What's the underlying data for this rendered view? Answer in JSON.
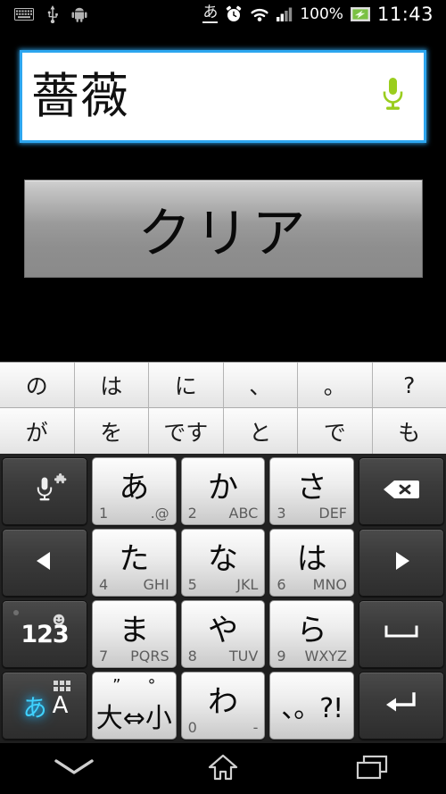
{
  "statusbar": {
    "left_icons": [
      "keyboard-icon",
      "usb-icon",
      "android-icon"
    ],
    "ime_indicator": "あ",
    "right_icons": [
      "alarm-icon",
      "wifi-icon",
      "signal-icon",
      "battery-icon"
    ],
    "battery_text": "100%",
    "clock": "11:43"
  },
  "textfield": {
    "value": "薔薇",
    "mic_icon": "microphone-icon",
    "border_color": "#2da6ef",
    "mic_color": "#9acd1e"
  },
  "clear_button": {
    "label": "クリア"
  },
  "keyboard": {
    "suggestions": {
      "row1": [
        "の",
        "は",
        "に",
        "、",
        "。",
        "?"
      ],
      "row2": [
        "が",
        "を",
        "です",
        "と",
        "で",
        "も"
      ]
    },
    "rows": [
      {
        "left": {
          "name": "voice-input-key",
          "icon": "microphone-icon",
          "badge": "puzzle-icon"
        },
        "keys": [
          {
            "main": "あ",
            "num": "1",
            "alpha": ".@"
          },
          {
            "main": "か",
            "num": "2",
            "alpha": "ABC"
          },
          {
            "main": "さ",
            "num": "3",
            "alpha": "DEF"
          }
        ],
        "right": {
          "name": "backspace-key",
          "icon": "backspace-icon"
        }
      },
      {
        "left": {
          "name": "cursor-left-key",
          "icon": "arrow-left-icon"
        },
        "keys": [
          {
            "main": "た",
            "num": "4",
            "alpha": "GHI"
          },
          {
            "main": "な",
            "num": "5",
            "alpha": "JKL"
          },
          {
            "main": "は",
            "num": "6",
            "alpha": "MNO"
          }
        ],
        "right": {
          "name": "cursor-right-key",
          "icon": "arrow-right-icon"
        }
      },
      {
        "left": {
          "name": "symbols-key",
          "label": "123",
          "badge": "emoji-icon"
        },
        "keys": [
          {
            "main": "ま",
            "num": "7",
            "alpha": "PQRS"
          },
          {
            "main": "や",
            "num": "8",
            "alpha": "TUV"
          },
          {
            "main": "ら",
            "num": "9",
            "alpha": "WXYZ"
          }
        ],
        "right": {
          "name": "space-key",
          "icon": "space-icon"
        }
      },
      {
        "left": {
          "name": "ime-toggle-key",
          "kana": "あ",
          "alpha": "A",
          "badge": "grid-icon"
        },
        "keys": [
          {
            "name": "dakuten-key",
            "top_left": "”",
            "top_right": "°",
            "main": "大⇔小"
          },
          {
            "main": "わ",
            "num": "0",
            "alpha": "-"
          },
          {
            "name": "punctuation-key",
            "main": "、。?!"
          }
        ],
        "right": {
          "name": "enter-key",
          "icon": "enter-icon"
        }
      }
    ]
  },
  "navbar": {
    "items": [
      {
        "name": "hide-keyboard-button",
        "icon": "chevron-down-icon"
      },
      {
        "name": "home-button",
        "icon": "home-icon"
      },
      {
        "name": "recents-button",
        "icon": "recents-icon"
      }
    ]
  }
}
